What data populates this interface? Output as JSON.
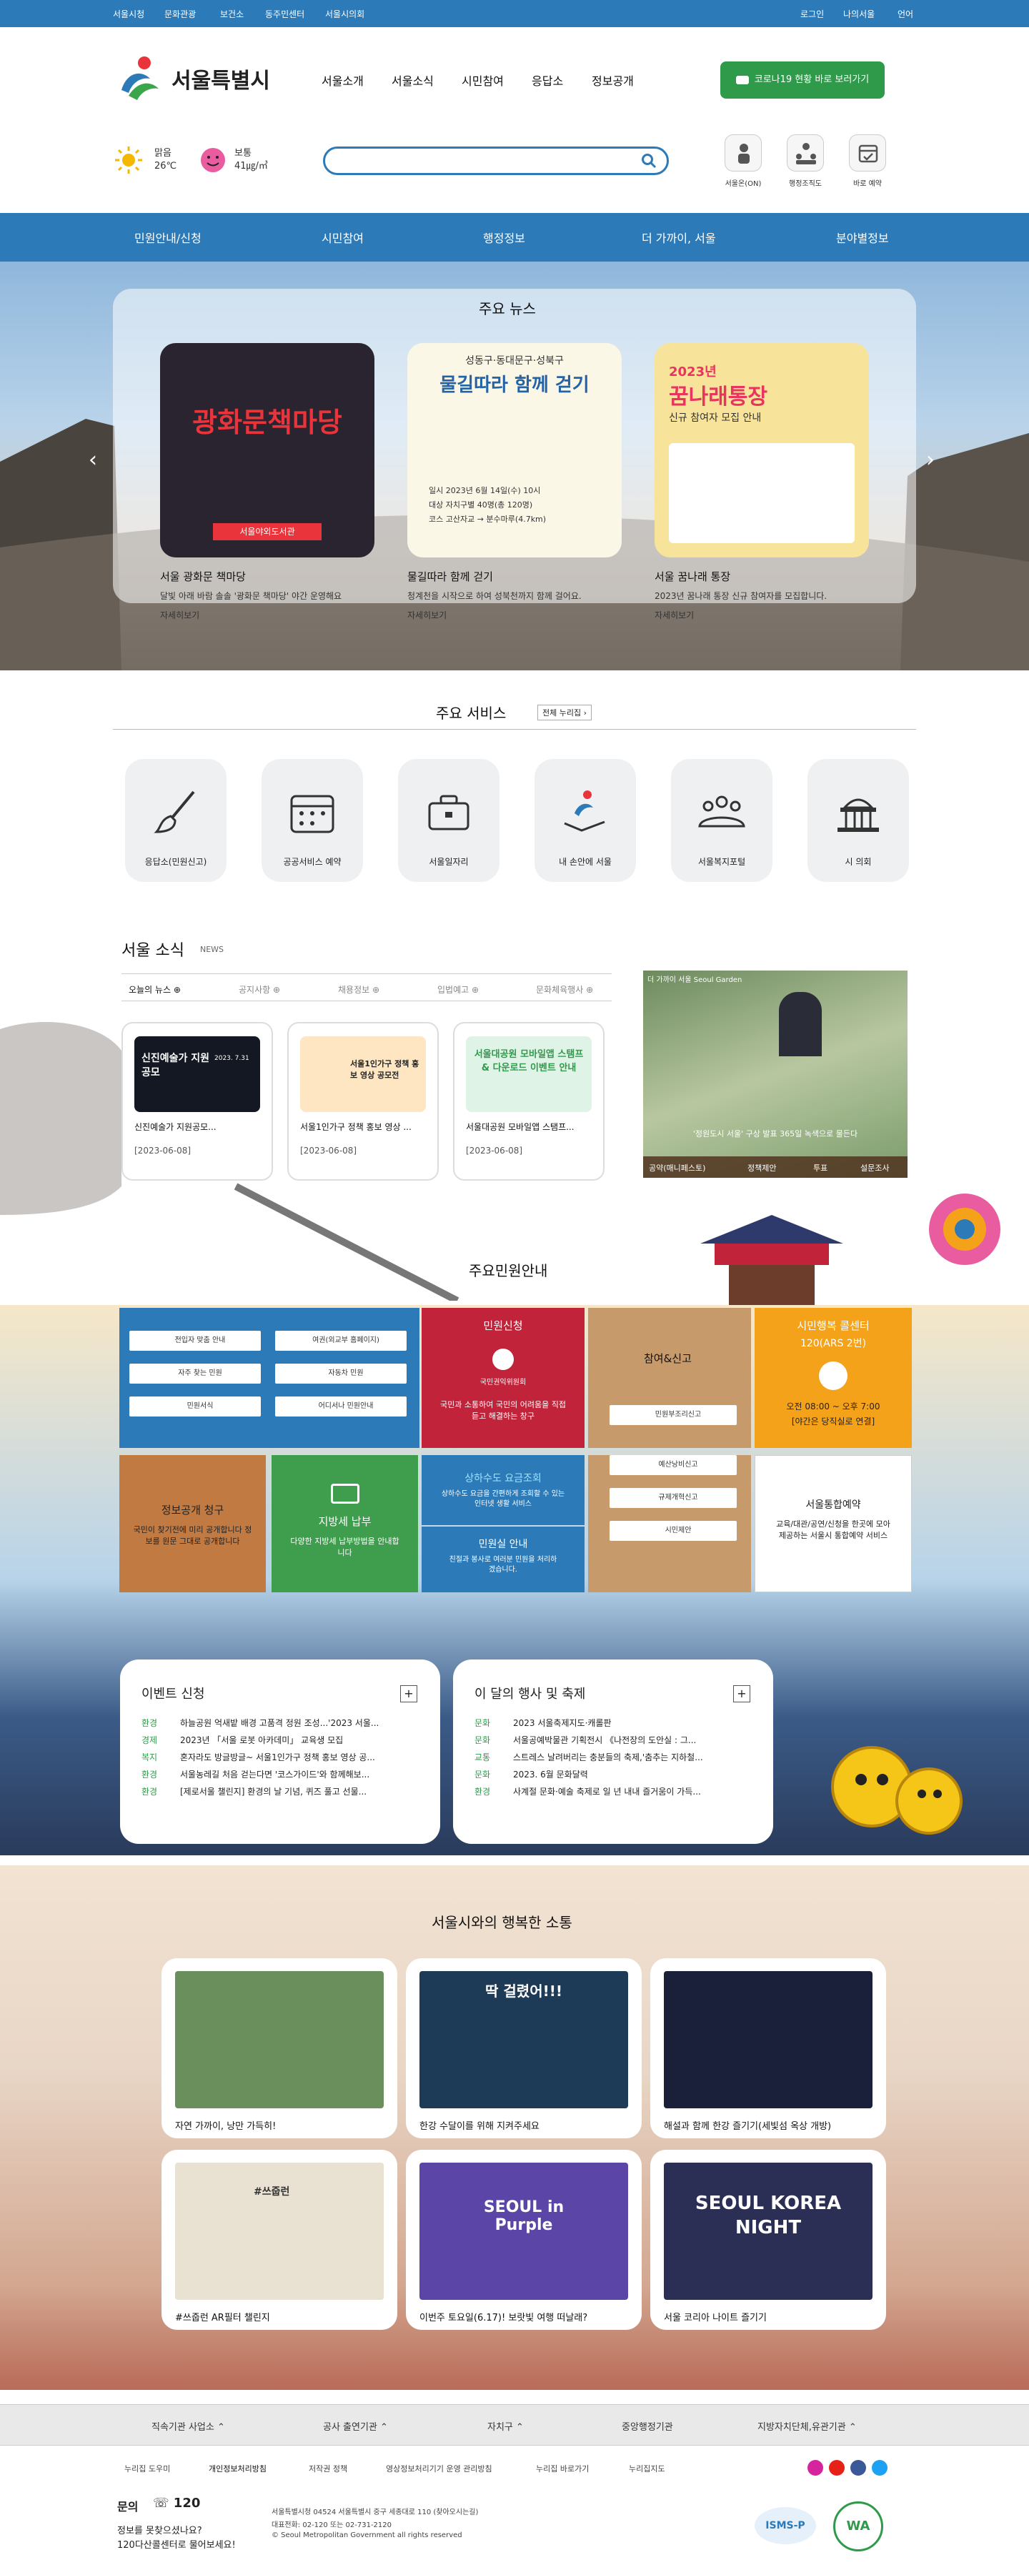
{
  "topbar": {
    "links": [
      "서울시청",
      "문화관광",
      "보건소",
      "동주민센터",
      "서울시의회"
    ],
    "right": [
      "로그인",
      "나의서울",
      "언어"
    ]
  },
  "logo": {
    "text": "서울특별시"
  },
  "gnb": [
    "서울소개",
    "서울소식",
    "시민참여",
    "응답소",
    "정보공개"
  ],
  "covid_button": "코로나19 현황 바로 보러가기",
  "weather": {
    "condition": "맑음",
    "temp": "26℃",
    "air": "보통",
    "pm": "41㎍/㎥"
  },
  "search": {
    "placeholder": ""
  },
  "quick": [
    "서울온(ON)",
    "행정조직도",
    "바로 예약"
  ],
  "mainnav": [
    "민원안내/신청",
    "시민참여",
    "행정정보",
    "더 가까이, 서울",
    "분야별정보"
  ],
  "news": {
    "title": "주요 뉴스",
    "items": [
      {
        "title": "서울 광화문 책마당",
        "desc": "달빛 아래 바람 솔솔 '광화문 책마당' 야간 운영해요",
        "more": "자세히보기",
        "poster_title": "광화문책마당",
        "poster_sub": "서울야외도서관"
      },
      {
        "title": "물길따라 함께 걷기",
        "desc": "청계천을 시작으로 하여 성북천까지 함께 걸어요.",
        "more": "자세히보기",
        "poster_head": "성동구·동대문구·성북구",
        "poster_title": "물길따라 함께 걷기",
        "poster_lines": [
          "일시  2023년 6월 14일(수) 10시",
          "대상  자치구별 40명(총 120명)",
          "코스  고산자교 → 분수마루(4.7km)"
        ]
      },
      {
        "title": "서울 꿈나래 통장",
        "desc": "2023년 꿈나래 통장 신규 참여자를 모집합니다.",
        "more": "자세히보기",
        "poster_year": "2023년",
        "poster_title": "꿈나래통장",
        "poster_sub": "신규 참여자 모집 안내"
      }
    ]
  },
  "services": {
    "title": "주요 서비스",
    "all": "전체 누리집",
    "items": [
      "응답소(민원신고)",
      "공공서비스 예약",
      "서울일자리",
      "내 손안에 서울",
      "서울복지포털",
      "시 의회"
    ]
  },
  "seoul_news": {
    "title": "서울 소식",
    "sub": "NEWS",
    "tabs": [
      "오늘의 뉴스",
      "공지사항",
      "채용정보",
      "입법예고",
      "문화체육행사"
    ],
    "cards": [
      {
        "title": "신진예술가 지원공모...",
        "date": "[2023-06-08]",
        "img_text": "신진예술가 지원공모",
        "img_date": "2023. 7.31"
      },
      {
        "title": "서울1인가구 정책 홍보 영상 ...",
        "date": "[2023-06-08]",
        "img_text": "서울1인가구 정책 홍보 영상 공모전"
      },
      {
        "title": "서울대공원 모바일앱 스탬프...",
        "date": "[2023-06-08]",
        "img_text": "서울대공원 모바일앱 스탬프 & 다운로드 이벤트 안내"
      }
    ],
    "photo": {
      "caption": "'정원도시 서울' 구상 발표 365일 녹색으로 물든다",
      "links": [
        "공약(매니페스토)",
        "정책제안",
        "투표",
        "설문조사"
      ],
      "overlay": "더 가까이 서울 Seoul Garden"
    }
  },
  "civil": {
    "title": "주요민원안내",
    "left_buttons": [
      "전입자 맞춤 안내",
      "여권(외교부 홈페이지)",
      "자주 찾는 민원",
      "자동차 민원",
      "민원서식",
      "어디서나 민원안내"
    ],
    "minwon": {
      "title": "민원신청",
      "org": "국민권익위원회",
      "desc": "국민과 소통하여 국민의 어려움을 직접 듣고 해결하는 창구"
    },
    "report": {
      "title": "참여&신고",
      "items": [
        "민원부조리신고",
        "예산낭비신고",
        "규제개혁신고",
        "시민제안"
      ]
    },
    "hotline": {
      "title": "시민행복 콜센터",
      "sub": "120(ARS 2번)",
      "hours": "오전 08:00 ~ 오후 7:00",
      "note": "[야간은 당직실로 연결]"
    },
    "info": {
      "title": "정보공개 청구",
      "desc": "국민이 찾기전에 미리 공개합니다 정보를 원문 그대로 공개합니다"
    },
    "tax": {
      "title": "지방세 납부",
      "desc": "다양한 지방세 납부방법을 안내합니다"
    },
    "water": {
      "title": "상하수도 요금조회",
      "desc": "상하수도 요금을 간편하게 조회할 수 있는 인터넷 생활 서비스"
    },
    "room": {
      "title": "민원실 안내",
      "desc": "친절과 봉사로 여러분 민원을 처리하겠습니다."
    },
    "booking": {
      "title": "서울통합예약",
      "desc": "교육/대관/공연/신청을 한곳에 모아 제공하는 서울시 통합예약 서비스"
    }
  },
  "events": {
    "title": "이벤트 신청",
    "rows": [
      {
        "c": "환경",
        "t": "하늘공원 억새밭 배경 고품격 정원 조성...'2023 서울..."
      },
      {
        "c": "경제",
        "t": "2023년 「서울 로봇 아카데미」 교육생 모집"
      },
      {
        "c": "복지",
        "t": "혼자라도 방글방글~ 서울1인가구 정책 홍보 영상 공..."
      },
      {
        "c": "환경",
        "t": "서울농레길 처음 걷는다면 '코스가이드'와 함께해보..."
      },
      {
        "c": "환경",
        "t": "[제로서울 챌린지] 환경의 날 기념, 퀴즈 풀고 선물..."
      }
    ]
  },
  "monthly": {
    "title": "이 달의 행사 및 축제",
    "rows": [
      {
        "c": "문화",
        "t": "2023 서울축제지도·캐롤판"
      },
      {
        "c": "문화",
        "t": "서울공예박물관 기획전시 《나전장의 도안실 : 그..."
      },
      {
        "c": "교통",
        "t": "스트레스 날려버리는 충분들의 축제,'춤추는 지하철..."
      },
      {
        "c": "문화",
        "t": "2023. 6월 문화달력"
      },
      {
        "c": "환경",
        "t": "사계절 문화·예술 축제로 일 년 내내 즐거움이 가득..."
      }
    ]
  },
  "comm": {
    "title": "서울시와의 행복한 소통",
    "items": [
      "자연 가까이, 낭만 가득히!",
      "한강 수달이를 위해 지켜주세요",
      "해설과 함께 한강 즐기기(세빛섬 옥상 개방)",
      "#쓰줍런 AR필터 챌린지",
      "이번주 토요일(6.17)! 보랏빛 여행 떠날래?",
      "서울 코리아 나이트 즐기기"
    ],
    "img_texts": [
      "",
      "딱 걸렸어!!!",
      "",
      "#쓰줍런",
      "SEOUL in Purple",
      "SEOUL KOREA NIGHT"
    ]
  },
  "footer": {
    "links": [
      "직속기관 사업소",
      "공사 출연기관",
      "자치구",
      "중앙행정기관",
      "지방자치단체,유관기관"
    ],
    "policy": [
      "누리집 도우미",
      "개인정보처리방침",
      "저작권 정책",
      "영상정보처리기기 운영 관리방침",
      "누리집 바로가기",
      "누리집지도"
    ],
    "contact": "문의",
    "phone": "120",
    "q1": "정보를 못찾으셨나요?",
    "q2": "120다산콜센터로 물어보세요!",
    "addr": "서울특별시청 04524 서울특별시 중구 세종대로 110 (찾아오시는길)",
    "tel": "대표전화: 02-120 또는 02-731-2120",
    "copy": "© Seoul Metropolitan Government all rights reserved",
    "badges": [
      "ISMS-P",
      "WA"
    ]
  },
  "colors": {
    "primary": "#2c7ab8",
    "green": "#2f9b4a",
    "red": "#c0233a",
    "orange": "#f5a21b",
    "tan": "#c79a6c"
  }
}
